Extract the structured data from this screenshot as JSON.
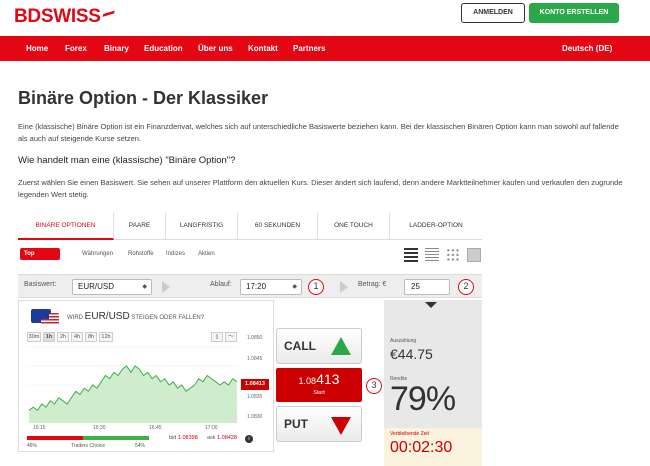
{
  "header": {
    "logo": "BDSWISS",
    "login_label": "ANMELDEN",
    "signup_label": "KONTO ERSTELLEN",
    "accent_color": "#e30613",
    "signup_color": "#2ba84a"
  },
  "nav": {
    "items": [
      "Home",
      "Forex",
      "Binary",
      "Education",
      "Über uns",
      "Kontakt",
      "Partners"
    ],
    "language": "Deutsch (DE)"
  },
  "content": {
    "title": "Binäre Option - Der Klassiker",
    "intro": "Eine (klassische) Binäre Option ist ein Finanzderivat, welches sich auf unterschiedliche Basiswerte beziehen kann. Bei der klassischen Binären Option kann man sowohl auf fallende als auch auf steigende Kurse setzen.",
    "subheading": "Wie handelt man eine (klassische) \"Binäre Option\"?",
    "paragraph": "Zuerst wählen Sie einen Basiswert. Sie sehen auf unserer Plattform den aktuellen Kurs. Dieser ändert sich laufend, denn andere Marktteilnehmer kaufen und verkaufen den zugrunde legenden Wert stetig."
  },
  "widget": {
    "tabs": [
      "BINÄRE OPTIONEN",
      "PAARE",
      "LANGFRISTIG",
      "60 SEKUNDEN",
      "ONE TOUCH",
      "LADDER-OPTION"
    ],
    "subtabs": [
      "Top Basiswerte",
      "Währungen",
      "Rohstoffe",
      "Indizes",
      "Aktien"
    ],
    "view_icons": [
      "list-view-icon",
      "compact-list-icon",
      "grid-view-icon",
      "tile-view-icon"
    ],
    "basiswert_label": "Basiswert:",
    "basiswert_value": "EUR/USD",
    "ablauf_label": "Ablauf:",
    "ablauf_value": "17:20",
    "betrag_label": "Betrag: €",
    "betrag_value": "25",
    "steps": [
      "1",
      "2",
      "3"
    ],
    "chart_question_pre": "WIRD",
    "chart_pair": "EUR/USD",
    "chart_question_post": "STEIGEN ODER FALLEN?",
    "timeframes": [
      "30m",
      "1h",
      "2h",
      "4h",
      "8h",
      "12h"
    ],
    "active_timeframe": "1h",
    "call_label": "CALL",
    "put_label": "PUT",
    "price_prefix": "1.08",
    "price_main": "413",
    "start_label": "Start",
    "sentiment_left": "46%",
    "sentiment_label": "Traders Choice",
    "sentiment_right": "54%",
    "sentiment_puts": 0.46,
    "bid_label": "bid",
    "bid_value": "1.08398",
    "ask_label": "ask",
    "ask_value": "1.08428",
    "payout_label": "Auszahlung",
    "payout_value": "€44.75",
    "rendite_label": "Rendite",
    "rendite_value": "79%",
    "time_label": "Verbleibende Zeit",
    "time_value": "00:02:30"
  },
  "chart_data": {
    "type": "area",
    "x_ticks": [
      "16:15",
      "16:30",
      "16:45",
      "17:00"
    ],
    "y_ticks": [
      "1.0850",
      "1.0845",
      "1.0840",
      "1.0835",
      "1.0830"
    ],
    "current_price": "1.08413",
    "ylim": [
      1.0828,
      1.0852
    ],
    "values": [
      1.0832,
      1.0833,
      1.0832,
      1.0834,
      1.0833,
      1.0835,
      1.0834,
      1.0836,
      1.0835,
      1.0834,
      1.0836,
      1.0838,
      1.0837,
      1.0839,
      1.0838,
      1.084,
      1.0839,
      1.0841,
      1.0843,
      1.0842,
      1.0844,
      1.0843,
      1.0845,
      1.0846,
      1.0844,
      1.0846,
      1.0845,
      1.0843,
      1.0844,
      1.0842,
      1.0843,
      1.0841,
      1.0842,
      1.084,
      1.0841,
      1.0839,
      1.084,
      1.0838,
      1.0839,
      1.084,
      1.0842,
      1.0841,
      1.0843,
      1.0842,
      1.0841,
      1.084,
      1.0841,
      1.084,
      1.0842,
      1.0841
    ],
    "line_color": "#3fb04a"
  }
}
